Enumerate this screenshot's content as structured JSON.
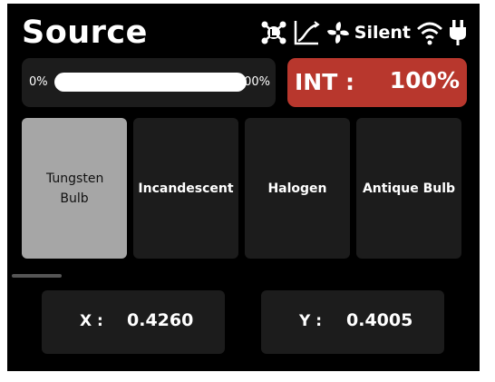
{
  "header": {
    "title": "Source",
    "status_icons": [
      "network-icon",
      "curve-icon",
      "fan-icon",
      "wifi-icon",
      "power-plug-icon"
    ],
    "fan_mode": "Silent"
  },
  "intensity_bar": {
    "min_label": "0%",
    "max_label": "100%",
    "level_percent": 100
  },
  "intensity": {
    "label": "INT :",
    "value": "100%"
  },
  "sources": [
    {
      "label": "Tungsten Bulb",
      "selected": true
    },
    {
      "label": "Incandescent",
      "selected": false
    },
    {
      "label": "Halogen",
      "selected": false
    },
    {
      "label": "Antique Bulb",
      "selected": false
    }
  ],
  "coordinates": {
    "x_label": "X :",
    "x_value": "0.4260",
    "y_label": "Y :",
    "y_value": "0.4005"
  },
  "colors": {
    "background": "#000000",
    "panel": "#1c1c1c",
    "selected": "#a6a6a6",
    "accent": "#b8372d",
    "text": "#ffffff"
  }
}
